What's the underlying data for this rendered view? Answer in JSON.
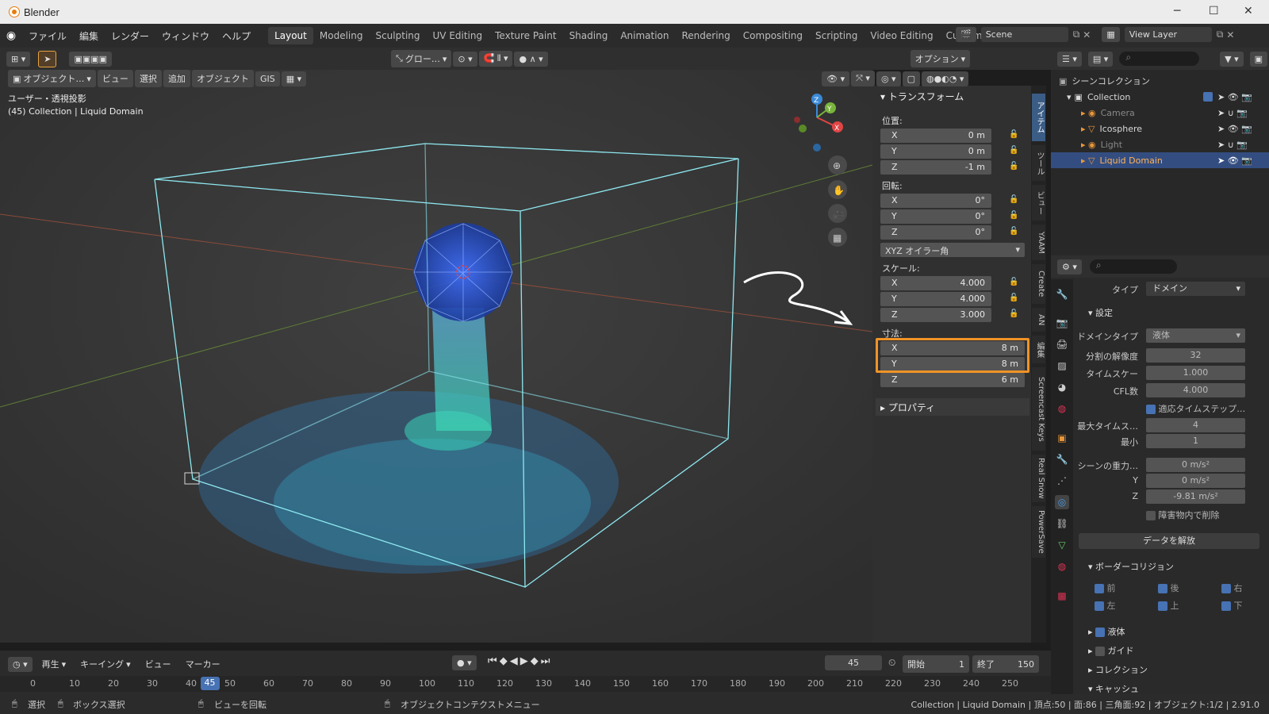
{
  "window": {
    "title": "Blender"
  },
  "menu": [
    "ファイル",
    "編集",
    "レンダー",
    "ウィンドウ",
    "ヘルプ"
  ],
  "workspaces": [
    "Layout",
    "Modeling",
    "Sculpting",
    "UV Editing",
    "Texture Paint",
    "Shading",
    "Animation",
    "Rendering",
    "Compositing",
    "Scripting",
    "Video Editing",
    "Custom"
  ],
  "workspace_add": "+",
  "scene": "Scene",
  "view_layer": "View Layer",
  "toolbar": {
    "transform_orient": "グロー…",
    "options": "オプション"
  },
  "vp_header": {
    "mode": "オブジェクト…",
    "view": "ビュー",
    "select": "選択",
    "add": "追加",
    "object": "オブジェクト",
    "gis": "GIS"
  },
  "viewport": {
    "line1": "ユーザー・透視投影",
    "line2": "(45) Collection | Liquid Domain"
  },
  "npanel": {
    "transform_title": "トランスフォーム",
    "location_label": "位置:",
    "location": [
      {
        "k": "X",
        "v": "0 m"
      },
      {
        "k": "Y",
        "v": "0 m"
      },
      {
        "k": "Z",
        "v": "-1 m"
      }
    ],
    "rotation_label": "回転:",
    "rotation": [
      {
        "k": "X",
        "v": "0°"
      },
      {
        "k": "Y",
        "v": "0°"
      },
      {
        "k": "Z",
        "v": "0°"
      }
    ],
    "rotation_mode": "XYZ オイラー角",
    "scale_label": "スケール:",
    "scale": [
      {
        "k": "X",
        "v": "4.000"
      },
      {
        "k": "Y",
        "v": "4.000"
      },
      {
        "k": "Z",
        "v": "3.000"
      }
    ],
    "dimensions_label": "寸法:",
    "dimensions": [
      {
        "k": "X",
        "v": "8 m"
      },
      {
        "k": "Y",
        "v": "8 m"
      },
      {
        "k": "Z",
        "v": "6 m"
      }
    ],
    "properties_title": "プロパティ"
  },
  "side_tabs": [
    "アイテム",
    "ツール",
    "ビュー",
    "YAAM",
    "Create",
    "AN",
    "編集",
    "Screencast Keys",
    "Real Snow",
    "PowerSave"
  ],
  "outliner": {
    "root": "シーンコレクション",
    "items": [
      {
        "name": "Collection"
      },
      {
        "name": "Camera"
      },
      {
        "name": "Icosphere"
      },
      {
        "name": "Light"
      },
      {
        "name": "Liquid Domain"
      }
    ]
  },
  "properties": {
    "type_label": "タイプ",
    "type_value": "ドメイン",
    "settings_title": "設定",
    "domain_type_label": "ドメインタイプ",
    "domain_type": "液体",
    "resolution_label": "分割の解像度",
    "resolution": "32",
    "time_scale_label": "タイムスケー",
    "time_scale": "1.000",
    "cfl_label": "CFL数",
    "cfl": "4.000",
    "adaptive_label": "適応タイムステップ…",
    "max_time_label": "最大タイムス…",
    "max_time": "4",
    "min_label": "最小",
    "min": "1",
    "gravity_label": "シーンの重力…",
    "gravity_x": "0 m/s²",
    "y_label": "Y",
    "gravity_y": "0 m/s²",
    "z_label": "Z",
    "gravity_z": "-9.81 m/s²",
    "delete_in_obstacle": "障害物内で削除",
    "free_data": "データを解放",
    "border_title": "ボーダーコリジョン",
    "border": [
      "前",
      "後",
      "右",
      "左",
      "上",
      "下"
    ],
    "liquid": "液体",
    "guide": "ガイド",
    "collection": "コレクション",
    "cache": "キャッシュ"
  },
  "timeline": {
    "play": "再生",
    "keying": "キーイング",
    "view": "ビュー",
    "marker": "マーカー",
    "current": "45",
    "start_label": "開始",
    "start": "1",
    "end_label": "終了",
    "end": "150",
    "ticks": [
      "0",
      "10",
      "20",
      "30",
      "40",
      "50",
      "60",
      "70",
      "80",
      "90",
      "100",
      "110",
      "120",
      "130",
      "140",
      "150",
      "160",
      "170",
      "180",
      "190",
      "200",
      "210",
      "220",
      "230",
      "240",
      "250"
    ]
  },
  "status": {
    "select": "選択",
    "box_select": "ボックス選択",
    "rotate_view": "ビューを回転",
    "context_menu": "オブジェクトコンテクストメニュー",
    "info": "Collection | Liquid Domain | 頂点:50 | 面:86 | 三角面:92 | オブジェクト:1/2 | 2.91.0"
  },
  "colors": {
    "accent": "#f09327",
    "selected": "#4772b3",
    "bg": "#3b3b3b"
  }
}
